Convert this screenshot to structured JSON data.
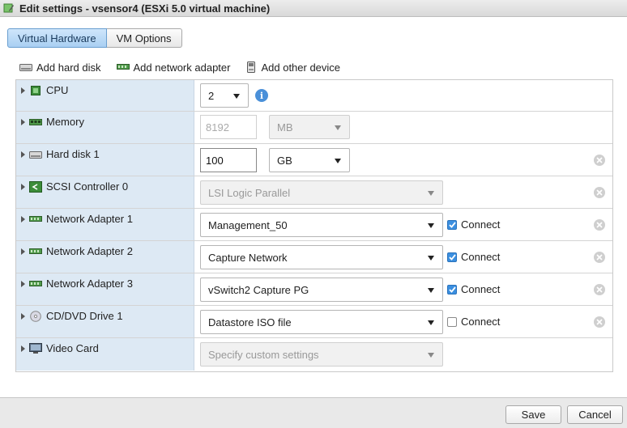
{
  "window": {
    "title": "Edit settings - vsensor4 (ESXi 5.0 virtual machine)",
    "icon": "vm-edit-icon"
  },
  "tabs": [
    {
      "label": "Virtual Hardware",
      "active": true
    },
    {
      "label": "VM Options",
      "active": false
    }
  ],
  "toolbar": {
    "add_hard_disk": "Add hard disk",
    "add_network_adapter": "Add network adapter",
    "add_other_device": "Add other device"
  },
  "devices": {
    "cpu": {
      "label": "CPU",
      "value": "2",
      "icon": "cpu-chip-icon"
    },
    "memory": {
      "label": "Memory",
      "value": "8192",
      "unit": "MB",
      "icon": "memory-module-icon"
    },
    "hard_disk_1": {
      "label": "Hard disk 1",
      "value": "100",
      "unit": "GB",
      "icon": "hard-disk-icon"
    },
    "scsi_controller_0": {
      "label": "SCSI Controller 0",
      "value": "LSI Logic Parallel",
      "icon": "scsi-controller-icon"
    },
    "network_adapter_1": {
      "label": "Network Adapter 1",
      "value": "Management_50",
      "connect_label": "Connect",
      "connected": true,
      "icon": "network-card-icon"
    },
    "network_adapter_2": {
      "label": "Network Adapter 2",
      "value": "Capture Network",
      "connect_label": "Connect",
      "connected": true,
      "icon": "network-card-icon"
    },
    "network_adapter_3": {
      "label": "Network Adapter 3",
      "value": "vSwitch2 Capture PG",
      "connect_label": "Connect",
      "connected": true,
      "icon": "network-card-icon"
    },
    "cd_dvd_drive_1": {
      "label": "CD/DVD Drive 1",
      "value": "Datastore ISO file",
      "connect_label": "Connect",
      "connected": false,
      "icon": "cd-disc-icon"
    },
    "video_card": {
      "label": "Video Card",
      "value": "Specify custom settings",
      "icon": "monitor-icon"
    }
  },
  "footer": {
    "save_label": "Save",
    "cancel_label": "Cancel"
  },
  "colors": {
    "left_column_bg": "#dde9f4",
    "accent": "#3b8fe0",
    "info": "#4a90d9"
  }
}
